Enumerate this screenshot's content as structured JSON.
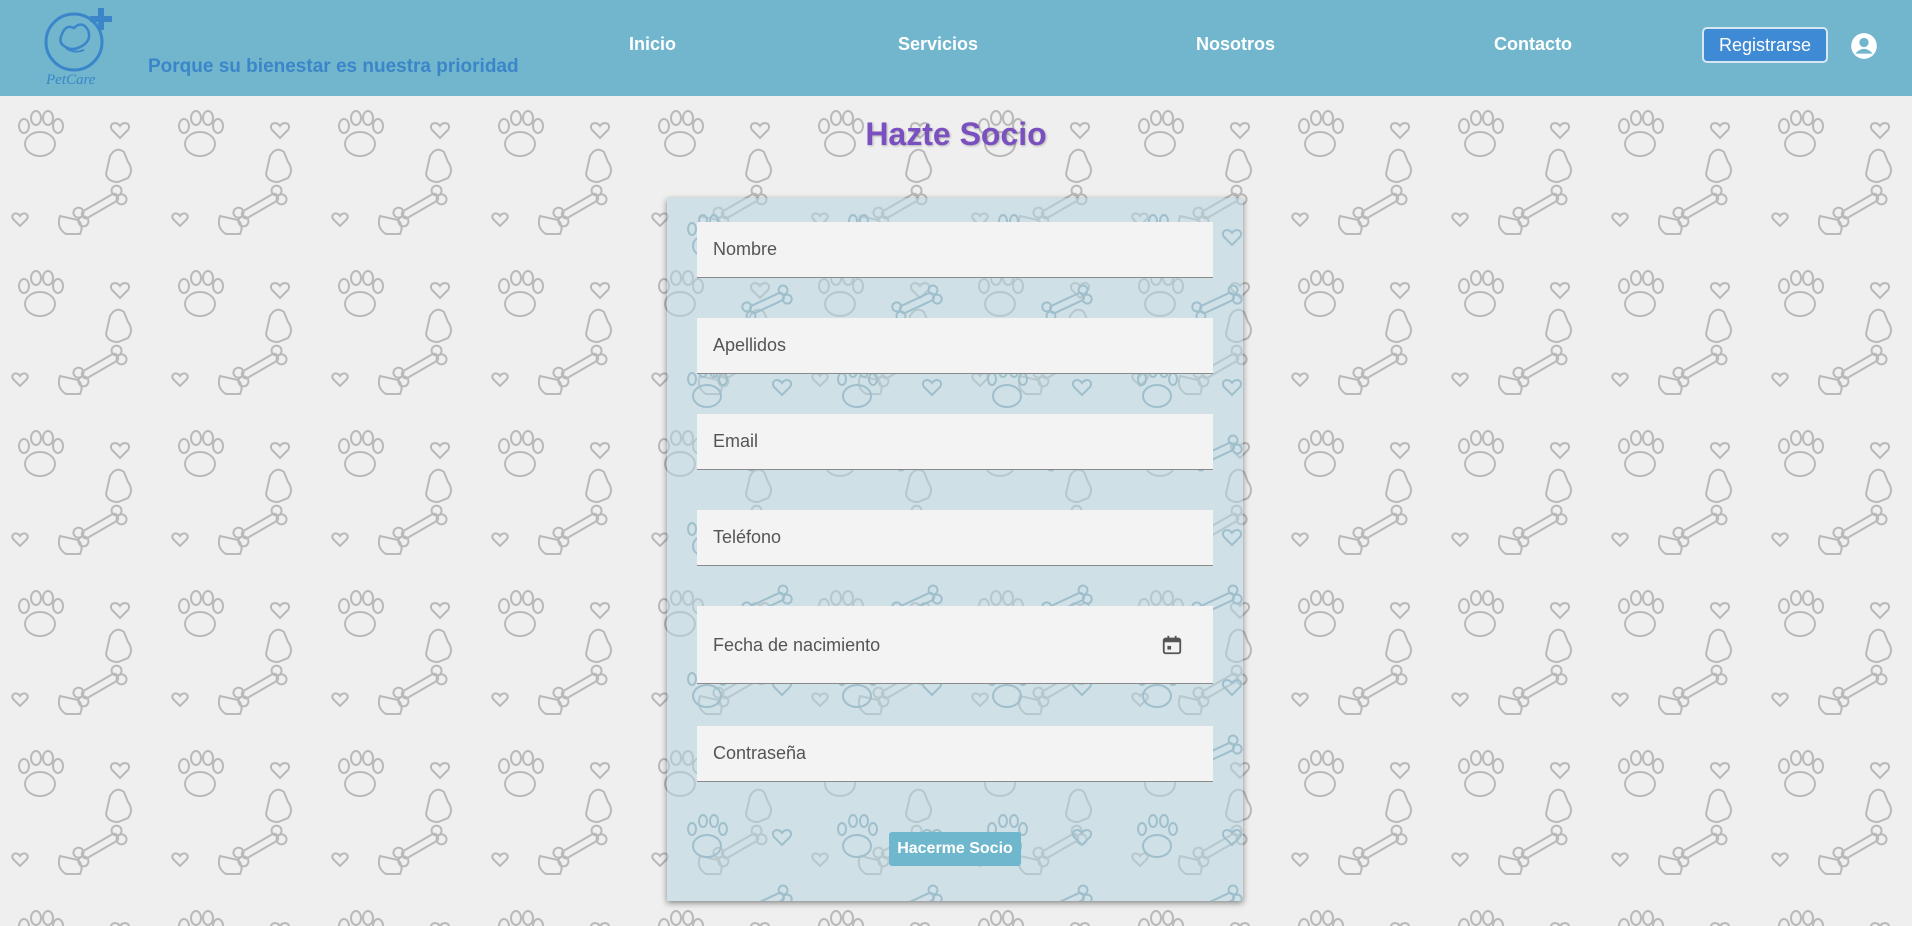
{
  "header": {
    "logo_text": "PetCare",
    "tagline": "Porque su bienestar es nuestra prioridad",
    "nav": [
      "Inicio",
      "Servicios",
      "Nosotros",
      "Contacto"
    ],
    "register_label": "Registrarse",
    "account_icon": "account-circle-icon",
    "background_color": "#71b6cd"
  },
  "page": {
    "title": "Hazte Socio"
  },
  "form": {
    "fields": [
      {
        "label": "Nombre"
      },
      {
        "label": "Apellidos"
      },
      {
        "label": "Email"
      },
      {
        "label": "Teléfono"
      },
      {
        "label": "Fecha de nacimiento",
        "icon": "calendar-icon"
      },
      {
        "label": "Contraseña"
      }
    ],
    "submit_label": "Hacerme Socio"
  },
  "colors": {
    "title": "#7a4fbf",
    "register_button": "#3f8ad5",
    "submit_button": "#6fb7cc"
  }
}
